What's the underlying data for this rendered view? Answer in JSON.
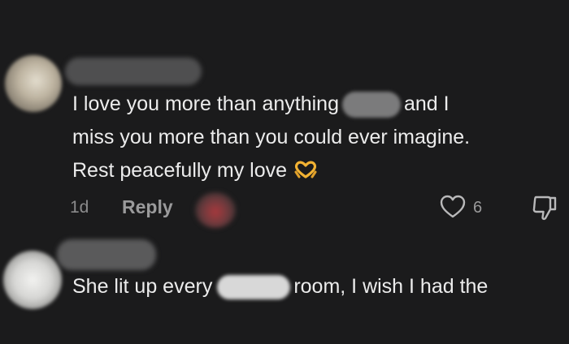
{
  "comments": [
    {
      "text_before_redaction": "I love you more than anything",
      "text_after_redaction": "and I",
      "line_2": "miss you more than you could ever imagine.",
      "line_3": "Rest peacefully my love",
      "emoji": "heart-hands-emoji",
      "time": "1d",
      "reply_label": "Reply",
      "like_count": "6",
      "icons": {
        "like": "heart-outline-icon",
        "dislike": "thumbs-down-icon"
      }
    },
    {
      "text_before_redaction": "She lit up every",
      "text_after_redaction": "room, I wish I had the"
    }
  ],
  "colors": {
    "background": "#1b1b1c",
    "text": "#ececec",
    "muted_text": "#8b8b8c",
    "icon": "#b9b9ba",
    "emoji": "#f2b233"
  }
}
